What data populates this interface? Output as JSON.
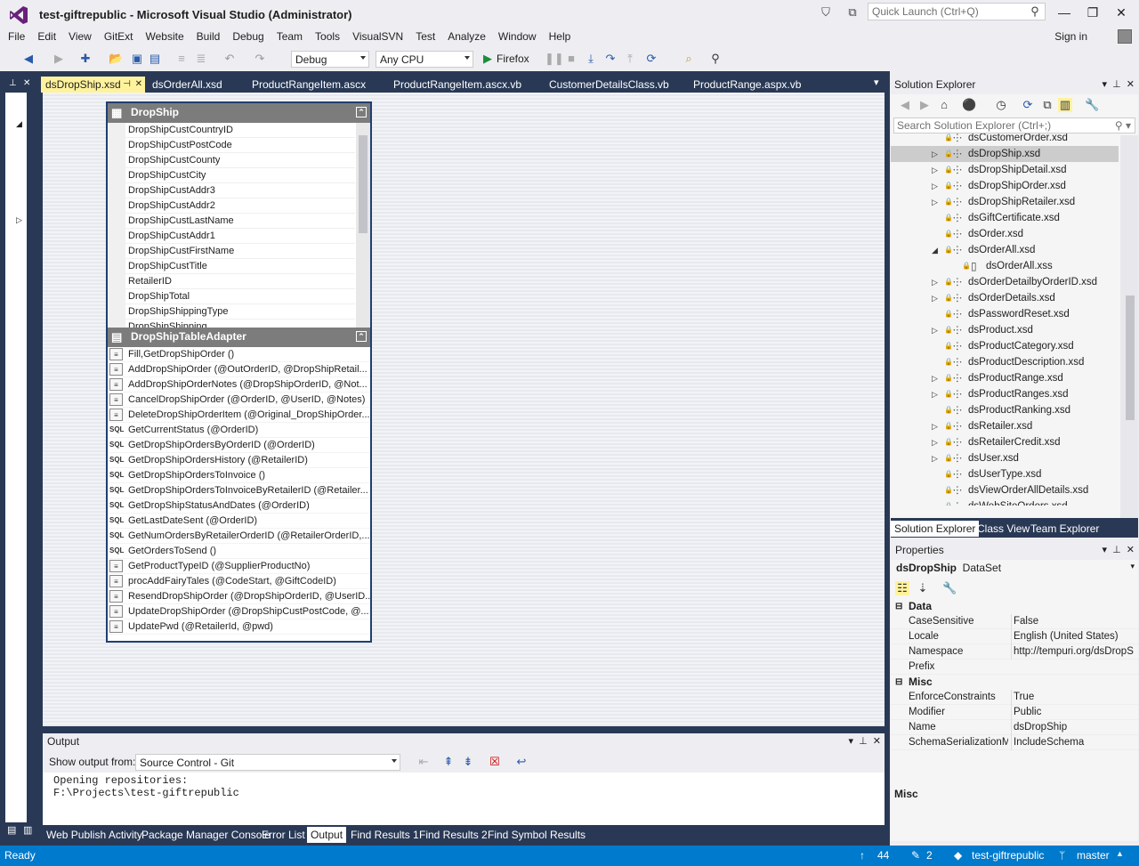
{
  "titlebar": {
    "title": "test-giftrepublic - Microsoft Visual Studio (Administrator)",
    "quick_launch": "Quick Launch (Ctrl+Q)"
  },
  "menus": [
    "File",
    "Edit",
    "View",
    "GitExt",
    "Website",
    "Build",
    "Debug",
    "Team",
    "Tools",
    "VisualSVN",
    "Test",
    "Analyze",
    "Window",
    "Help"
  ],
  "signin": "Sign in",
  "toolbar": {
    "config": "Debug",
    "platform": "Any CPU",
    "run": "Firefox"
  },
  "tabs": [
    "dsDropShip.xsd",
    "dsOrderAll.xsd",
    "ProductRangeItem.ascx",
    "ProductRangeItem.ascx.vb",
    "CustomerDetailsClass.vb",
    "ProductRange.aspx.vb"
  ],
  "datatable": {
    "name": "DropShip",
    "columns": [
      "DropShipCustCountryID",
      "DropShipCustPostCode",
      "DropShipCustCounty",
      "DropShipCustCity",
      "DropShipCustAddr3",
      "DropShipCustAddr2",
      "DropShipCustLastName",
      "DropShipCustAddr1",
      "DropShipCustFirstName",
      "DropShipCustTitle",
      "RetailerID",
      "DropShipTotal",
      "DropShipShippingType",
      "DropShipShipping"
    ],
    "adapter": "DropShipTableAdapter",
    "queries": [
      {
        "t": "q",
        "text": "Fill,GetDropShipOrder ()"
      },
      {
        "t": "q",
        "text": "AddDropShipOrder (@OutOrderID, @DropShipRetail..."
      },
      {
        "t": "q",
        "text": "AddDropShipOrderNotes (@DropShipOrderID, @Not..."
      },
      {
        "t": "q",
        "text": "CancelDropShipOrder (@OrderID, @UserID, @Notes)"
      },
      {
        "t": "q",
        "text": "DeleteDropShipOrderItem (@Original_DropShipOrder..."
      },
      {
        "t": "s",
        "text": "GetCurrentStatus (@OrderID)"
      },
      {
        "t": "s",
        "text": "GetDropShipOrdersByOrderID (@OrderID)"
      },
      {
        "t": "s",
        "text": "GetDropShipOrdersHistory (@RetailerID)"
      },
      {
        "t": "s",
        "text": "GetDropShipOrdersToInvoice ()"
      },
      {
        "t": "s",
        "text": "GetDropShipOrdersToInvoiceByRetailerID (@Retailer..."
      },
      {
        "t": "s",
        "text": "GetDropShipStatusAndDates (@OrderID)"
      },
      {
        "t": "s",
        "text": "GetLastDateSent (@OrderID)"
      },
      {
        "t": "s",
        "text": "GetNumOrdersByRetailerOrderID (@RetailerOrderID,..."
      },
      {
        "t": "s",
        "text": "GetOrdersToSend ()"
      },
      {
        "t": "q",
        "text": "GetProductTypeID (@SupplierProductNo)"
      },
      {
        "t": "q",
        "text": "procAddFairyTales (@CodeStart, @GiftCodeID)"
      },
      {
        "t": "q",
        "text": "ResendDropShipOrder (@DropShipOrderID, @UserID..."
      },
      {
        "t": "q",
        "text": "UpdateDropShipOrder (@DropShipCustPostCode, @..."
      },
      {
        "t": "q",
        "text": "UpdatePwd (@RetailerId, @pwd)"
      }
    ]
  },
  "output": {
    "title": "Output",
    "show_from_label": "Show output from:",
    "source": "Source Control - Git",
    "lines": [
      "Opening repositories:",
      "F:\\Projects\\test-giftrepublic"
    ]
  },
  "output_tabs": [
    "Web Publish Activity",
    "Package Manager Console",
    "Error List",
    "Output",
    "Find Results 1",
    "Find Results 2",
    "Find Symbol Results"
  ],
  "solution_explorer": {
    "title": "Solution Explorer",
    "search": "Search Solution Explorer (Ctrl+;)",
    "items": [
      {
        "name": "dsCustomerOrder.xsd",
        "arrow": ""
      },
      {
        "name": "dsDropShip.xsd",
        "arrow": "▷",
        "sel": true
      },
      {
        "name": "dsDropShipDetail.xsd",
        "arrow": "▷"
      },
      {
        "name": "dsDropShipOrder.xsd",
        "arrow": "▷"
      },
      {
        "name": "dsDropShipRetailer.xsd",
        "arrow": "▷"
      },
      {
        "name": "dsGiftCertificate.xsd",
        "arrow": ""
      },
      {
        "name": "dsOrder.xsd",
        "arrow": ""
      },
      {
        "name": "dsOrderAll.xsd",
        "arrow": "◢"
      },
      {
        "name": "dsOrderAll.xss",
        "arrow": "",
        "child": true
      },
      {
        "name": "dsOrderDetailbyOrderID.xsd",
        "arrow": "▷"
      },
      {
        "name": "dsOrderDetails.xsd",
        "arrow": "▷"
      },
      {
        "name": "dsPasswordReset.xsd",
        "arrow": ""
      },
      {
        "name": "dsProduct.xsd",
        "arrow": "▷"
      },
      {
        "name": "dsProductCategory.xsd",
        "arrow": ""
      },
      {
        "name": "dsProductDescription.xsd",
        "arrow": ""
      },
      {
        "name": "dsProductRange.xsd",
        "arrow": "▷"
      },
      {
        "name": "dsProductRanges.xsd",
        "arrow": "▷"
      },
      {
        "name": "dsProductRanking.xsd",
        "arrow": ""
      },
      {
        "name": "dsRetailer.xsd",
        "arrow": "▷"
      },
      {
        "name": "dsRetailerCredit.xsd",
        "arrow": "▷"
      },
      {
        "name": "dsUser.xsd",
        "arrow": "▷"
      },
      {
        "name": "dsUserType.xsd",
        "arrow": ""
      },
      {
        "name": "dsViewOrderAllDetails.xsd",
        "arrow": ""
      },
      {
        "name": "dsWebSiteOrders.xsd",
        "arrow": ""
      }
    ],
    "bottom_tabs": [
      "Solution Explorer",
      "Class View",
      "Team Explorer"
    ]
  },
  "properties": {
    "title": "Properties",
    "object": "dsDropShip",
    "type": "DataSet",
    "categories": [
      {
        "name": "Data",
        "rows": [
          [
            "CaseSensitive",
            "False"
          ],
          [
            "Locale",
            "English (United States)"
          ],
          [
            "Namespace",
            "http://tempuri.org/dsDropSh"
          ],
          [
            "Prefix",
            ""
          ]
        ]
      },
      {
        "name": "Misc",
        "rows": [
          [
            "EnforceConstraints",
            "True"
          ],
          [
            "Modifier",
            "Public"
          ],
          [
            "Name",
            "dsDropShip"
          ],
          [
            "SchemaSerializationMode",
            "IncludeSchema"
          ]
        ]
      }
    ],
    "description": "Misc"
  },
  "status": {
    "text": "Ready",
    "up": "44",
    "pencil": "2",
    "repo": "test-giftrepublic",
    "branch": "master"
  }
}
